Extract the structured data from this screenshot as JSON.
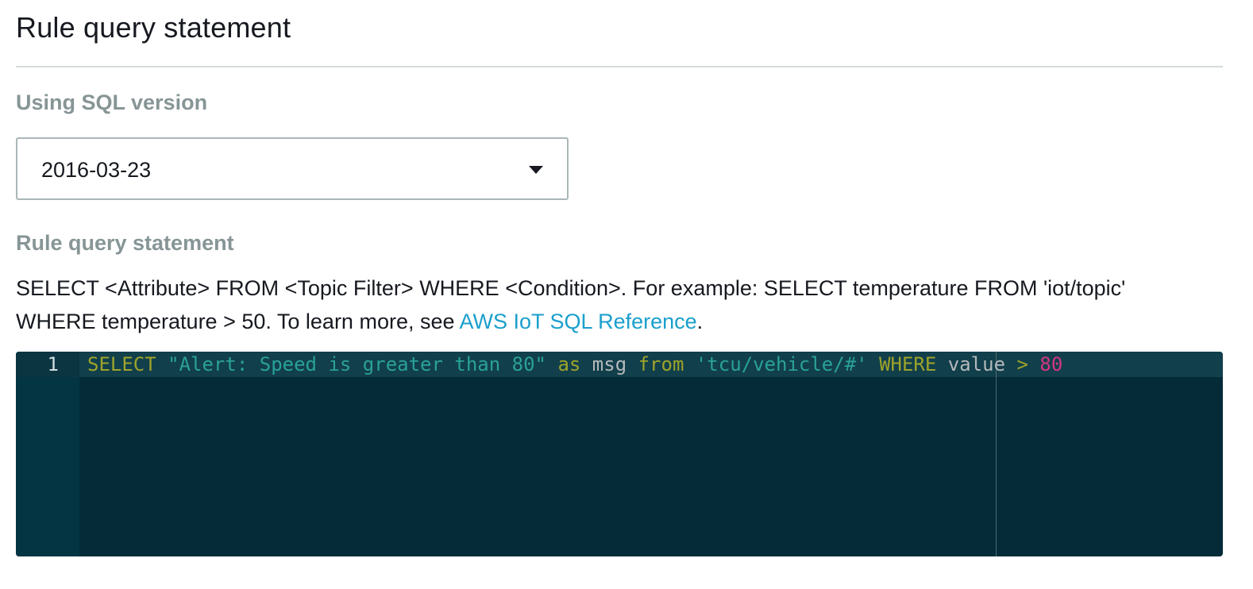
{
  "section": {
    "title": "Rule query statement"
  },
  "sql_version": {
    "label": "Using SQL version",
    "selected": "2016-03-23"
  },
  "query": {
    "label": "Rule query statement",
    "description_before_link": "SELECT <Attribute> FROM <Topic Filter> WHERE <Condition>. For example: SELECT temperature FROM 'iot/topic' WHERE temperature > 50. To learn more, see ",
    "link_text": "AWS IoT SQL Reference",
    "description_after_link": "."
  },
  "editor": {
    "line_number": "1",
    "tokens": [
      {
        "text": "SELECT",
        "type": "keyword"
      },
      {
        "text": " ",
        "type": "space"
      },
      {
        "text": "\"Alert: Speed is greater than 80\"",
        "type": "string"
      },
      {
        "text": " ",
        "type": "space"
      },
      {
        "text": "as",
        "type": "keyword"
      },
      {
        "text": " ",
        "type": "space"
      },
      {
        "text": "msg",
        "type": "identifier"
      },
      {
        "text": " ",
        "type": "space"
      },
      {
        "text": "from",
        "type": "keyword"
      },
      {
        "text": " ",
        "type": "space"
      },
      {
        "text": "'tcu/vehicle/#'",
        "type": "string"
      },
      {
        "text": " ",
        "type": "space"
      },
      {
        "text": "WHERE",
        "type": "keyword"
      },
      {
        "text": " ",
        "type": "space"
      },
      {
        "text": "value",
        "type": "identifier"
      },
      {
        "text": " ",
        "type": "space"
      },
      {
        "text": ">",
        "type": "operator"
      },
      {
        "text": " ",
        "type": "space"
      },
      {
        "text": "80",
        "type": "number"
      }
    ]
  }
}
